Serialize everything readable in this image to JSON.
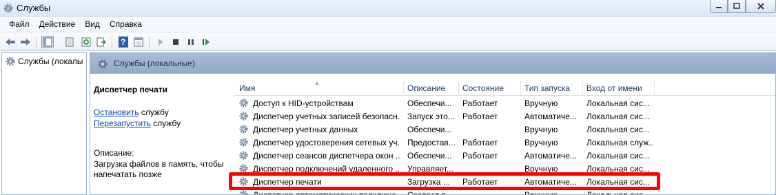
{
  "window": {
    "title": "Службы",
    "icon": "gear-icon",
    "controls": [
      "minimize",
      "maximize",
      "close"
    ]
  },
  "menu": [
    "Файл",
    "Действие",
    "Вид",
    "Справка"
  ],
  "toolbar": {
    "icons": [
      "back-arrow-icon",
      "forward-arrow-icon",
      "console-tree-icon",
      "properties-icon",
      "refresh-icon",
      "export-list-icon",
      "help-icon",
      "view-pane-icon",
      "play-icon",
      "stop-icon",
      "pause-icon",
      "restart-icon"
    ]
  },
  "tree": {
    "item_label": "Службы (локалы"
  },
  "header": {
    "title": "Службы (локальные)"
  },
  "details": {
    "service_name": "Диспетчер печати",
    "stop_link": "Остановить",
    "stop_suffix": " службу",
    "restart_link": "Перезапустить",
    "restart_suffix": " службу",
    "description_label": "Описание:",
    "description_text": "Загрузка файлов в память, чтобы напечатать позже"
  },
  "table": {
    "columns": [
      "Имя",
      "Описание",
      "Состояние",
      "Тип запуска",
      "Вход от имени"
    ],
    "rows": [
      [
        "Доступ к HID-устройствам",
        "Обеспечи...",
        "Работает",
        "Вручную",
        "Локальная сис..."
      ],
      [
        "Диспетчер учетных записей безопасн...",
        "Запуск это...",
        "Работает",
        "Автоматиче...",
        "Локальная сис..."
      ],
      [
        "Диспетчер учетных данных",
        "Обеспечи...",
        "",
        "Вручную",
        "Локальная сис..."
      ],
      [
        "Диспетчер удостоверения сетевых уч...",
        "Предостав...",
        "Работает",
        "Вручную",
        "Локальная служ..."
      ],
      [
        "Диспетчер сеансов диспетчера окон ...",
        "Обеспечи...",
        "Работает",
        "Автоматиче...",
        "Локальная сис..."
      ],
      [
        "Диспетчер подключений удаленного ...",
        "Управляет...",
        "",
        "Вручную",
        "Локальная сис..."
      ],
      [
        "Диспетчер печати",
        "Загрузка ...",
        "Работает",
        "Автоматиче...",
        "Локальная сис..."
      ],
      [
        "Диспетчер автоматических подключе...",
        "Создает п...",
        "",
        "Вручную",
        "Локальная сис..."
      ]
    ]
  },
  "colors": {
    "highlight": "#ff0000",
    "header_band": "#a8bdd4",
    "link": "#0645ad"
  }
}
